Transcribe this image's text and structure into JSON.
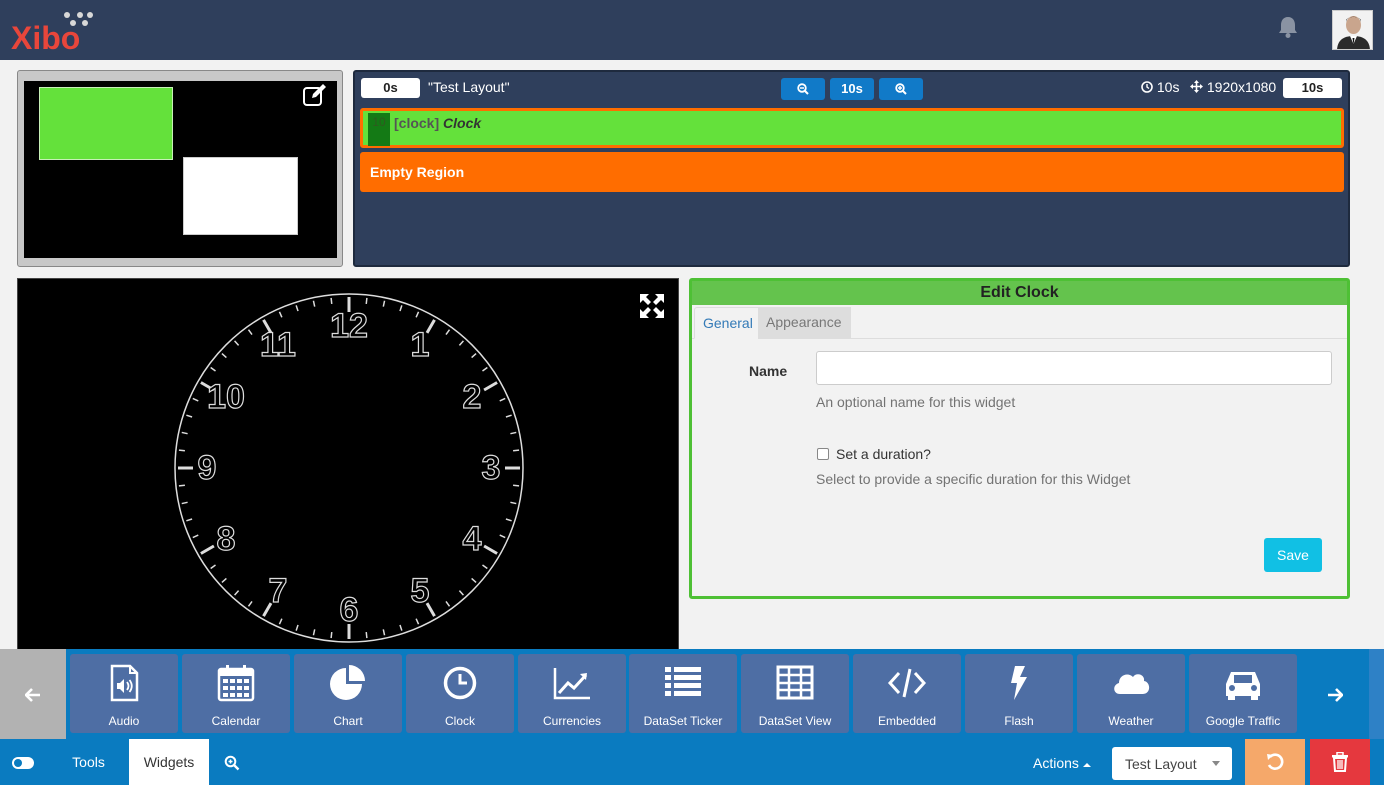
{
  "app": {
    "logo_text": "Xibo"
  },
  "preview": {
    "colors": {
      "region_green": "#64e13b",
      "region_white": "#ffffff"
    }
  },
  "timeline": {
    "start_time": "0s",
    "layout_name": "\"Test Layout\"",
    "zoom_level": "10s",
    "duration": "10s",
    "resolution": "1920x1080",
    "end_time": "10s",
    "regions": [
      {
        "duration": "10",
        "type_label": "[clock]",
        "name": "Clock",
        "color": "#64e13b"
      },
      {
        "label": "Empty Region",
        "color": "#ff6d00"
      }
    ]
  },
  "clock": {
    "numbers": [
      "12",
      "1",
      "2",
      "3",
      "4",
      "5",
      "6",
      "7",
      "8",
      "9",
      "10",
      "11"
    ]
  },
  "edit_panel": {
    "title": "Edit Clock",
    "tabs": [
      "General",
      "Appearance"
    ],
    "name_label": "Name",
    "name_value": "",
    "name_help": "An optional name for this widget",
    "duration_checkbox_label": "Set a duration?",
    "duration_checked": false,
    "duration_help": "Select to provide a specific duration for this Widget",
    "save_label": "Save"
  },
  "widgets": [
    {
      "label": "Audio",
      "icon": "audio-file-icon"
    },
    {
      "label": "Calendar",
      "icon": "calendar-icon"
    },
    {
      "label": "Chart",
      "icon": "pie-chart-icon"
    },
    {
      "label": "Clock",
      "icon": "clock-icon"
    },
    {
      "label": "Currencies",
      "icon": "line-chart-icon"
    },
    {
      "label": "DataSet Ticker",
      "icon": "list-icon"
    },
    {
      "label": "DataSet View",
      "icon": "table-icon"
    },
    {
      "label": "Embedded",
      "icon": "code-icon"
    },
    {
      "label": "Flash",
      "icon": "bolt-icon"
    },
    {
      "label": "Weather",
      "icon": "cloud-icon"
    },
    {
      "label": "Google Traffic",
      "icon": "car-icon"
    }
  ],
  "bottombar": {
    "tools_label": "Tools",
    "widgets_label": "Widgets",
    "actions_label": "Actions",
    "layout_select_value": "Test Layout"
  },
  "colors": {
    "topbar": "#2f3f5c",
    "accent_blue": "#0a7bc0",
    "widget_tile": "#4e6ea4",
    "edit_border": "#4ec035",
    "save_button": "#11c0e4",
    "undo_button": "#f5a86a",
    "delete_button": "#e5383e"
  }
}
